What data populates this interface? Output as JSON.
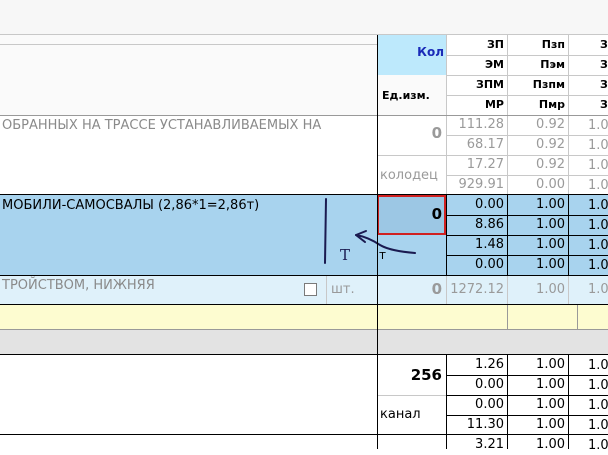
{
  "header": {
    "kol_label": "Кол",
    "unit_label": "Ед.изм.",
    "col1": [
      "ЗП",
      "ЭМ",
      "ЗПМ",
      "МР"
    ],
    "col2": [
      "Пзп",
      "Пэм",
      "Пзпм",
      "Пмр"
    ],
    "col3": [
      "З",
      "З",
      "З",
      "З"
    ]
  },
  "rows": {
    "r1": {
      "name": "ОБРАННЫХ НА ТРАССЕ УСТАНАВЛИВАЕМЫХ НА",
      "qty": "0",
      "unit": "колодец",
      "c1": [
        "111.28",
        "68.17",
        "17.27",
        "929.91"
      ],
      "c2": [
        "0.92",
        "0.92",
        "0.92",
        "0.00"
      ],
      "c3": [
        "1.0",
        "1.0",
        "1.0",
        "1.0"
      ]
    },
    "r2": {
      "name": "МОБИЛИ-САМОСВАЛЫ (2,86*1=2,86т)",
      "qty": "0",
      "unit": "т",
      "annotation_letter": "Т",
      "c1": [
        "0.00",
        "8.86",
        "1.48",
        "0.00"
      ],
      "c2": [
        "1.00",
        "1.00",
        "1.00",
        "1.00"
      ],
      "c3": [
        "1.0",
        "1.0",
        "1.0",
        "1.0"
      ]
    },
    "r3": {
      "name": "ТРОЙСТВОМ, НИЖНЯЯ",
      "unit": "шт.",
      "qty": "0",
      "c1": "1272.12",
      "c2": "1.00",
      "c3": "1.0"
    },
    "r4": {
      "qty": "256",
      "unit": "канал",
      "c1": [
        "1.26",
        "0.00",
        "0.00",
        "11.30",
        "3.21"
      ],
      "c2": [
        "1.00",
        "1.00",
        "1.00",
        "1.00",
        "1.00"
      ],
      "c3": [
        "1.0",
        "1.0",
        "1.0",
        "1.0",
        "1.0"
      ]
    }
  },
  "colors": {
    "kol_bg": "#bde9fc",
    "selected_row": "#a8d3ee",
    "light_row": "#dff1fa",
    "yellow_row": "#fdfcd0",
    "gray_band": "#e3e3e3",
    "kol_text": "#1a2bb8",
    "active_cell_border": "#d02020",
    "ink": "#1a1a50"
  }
}
